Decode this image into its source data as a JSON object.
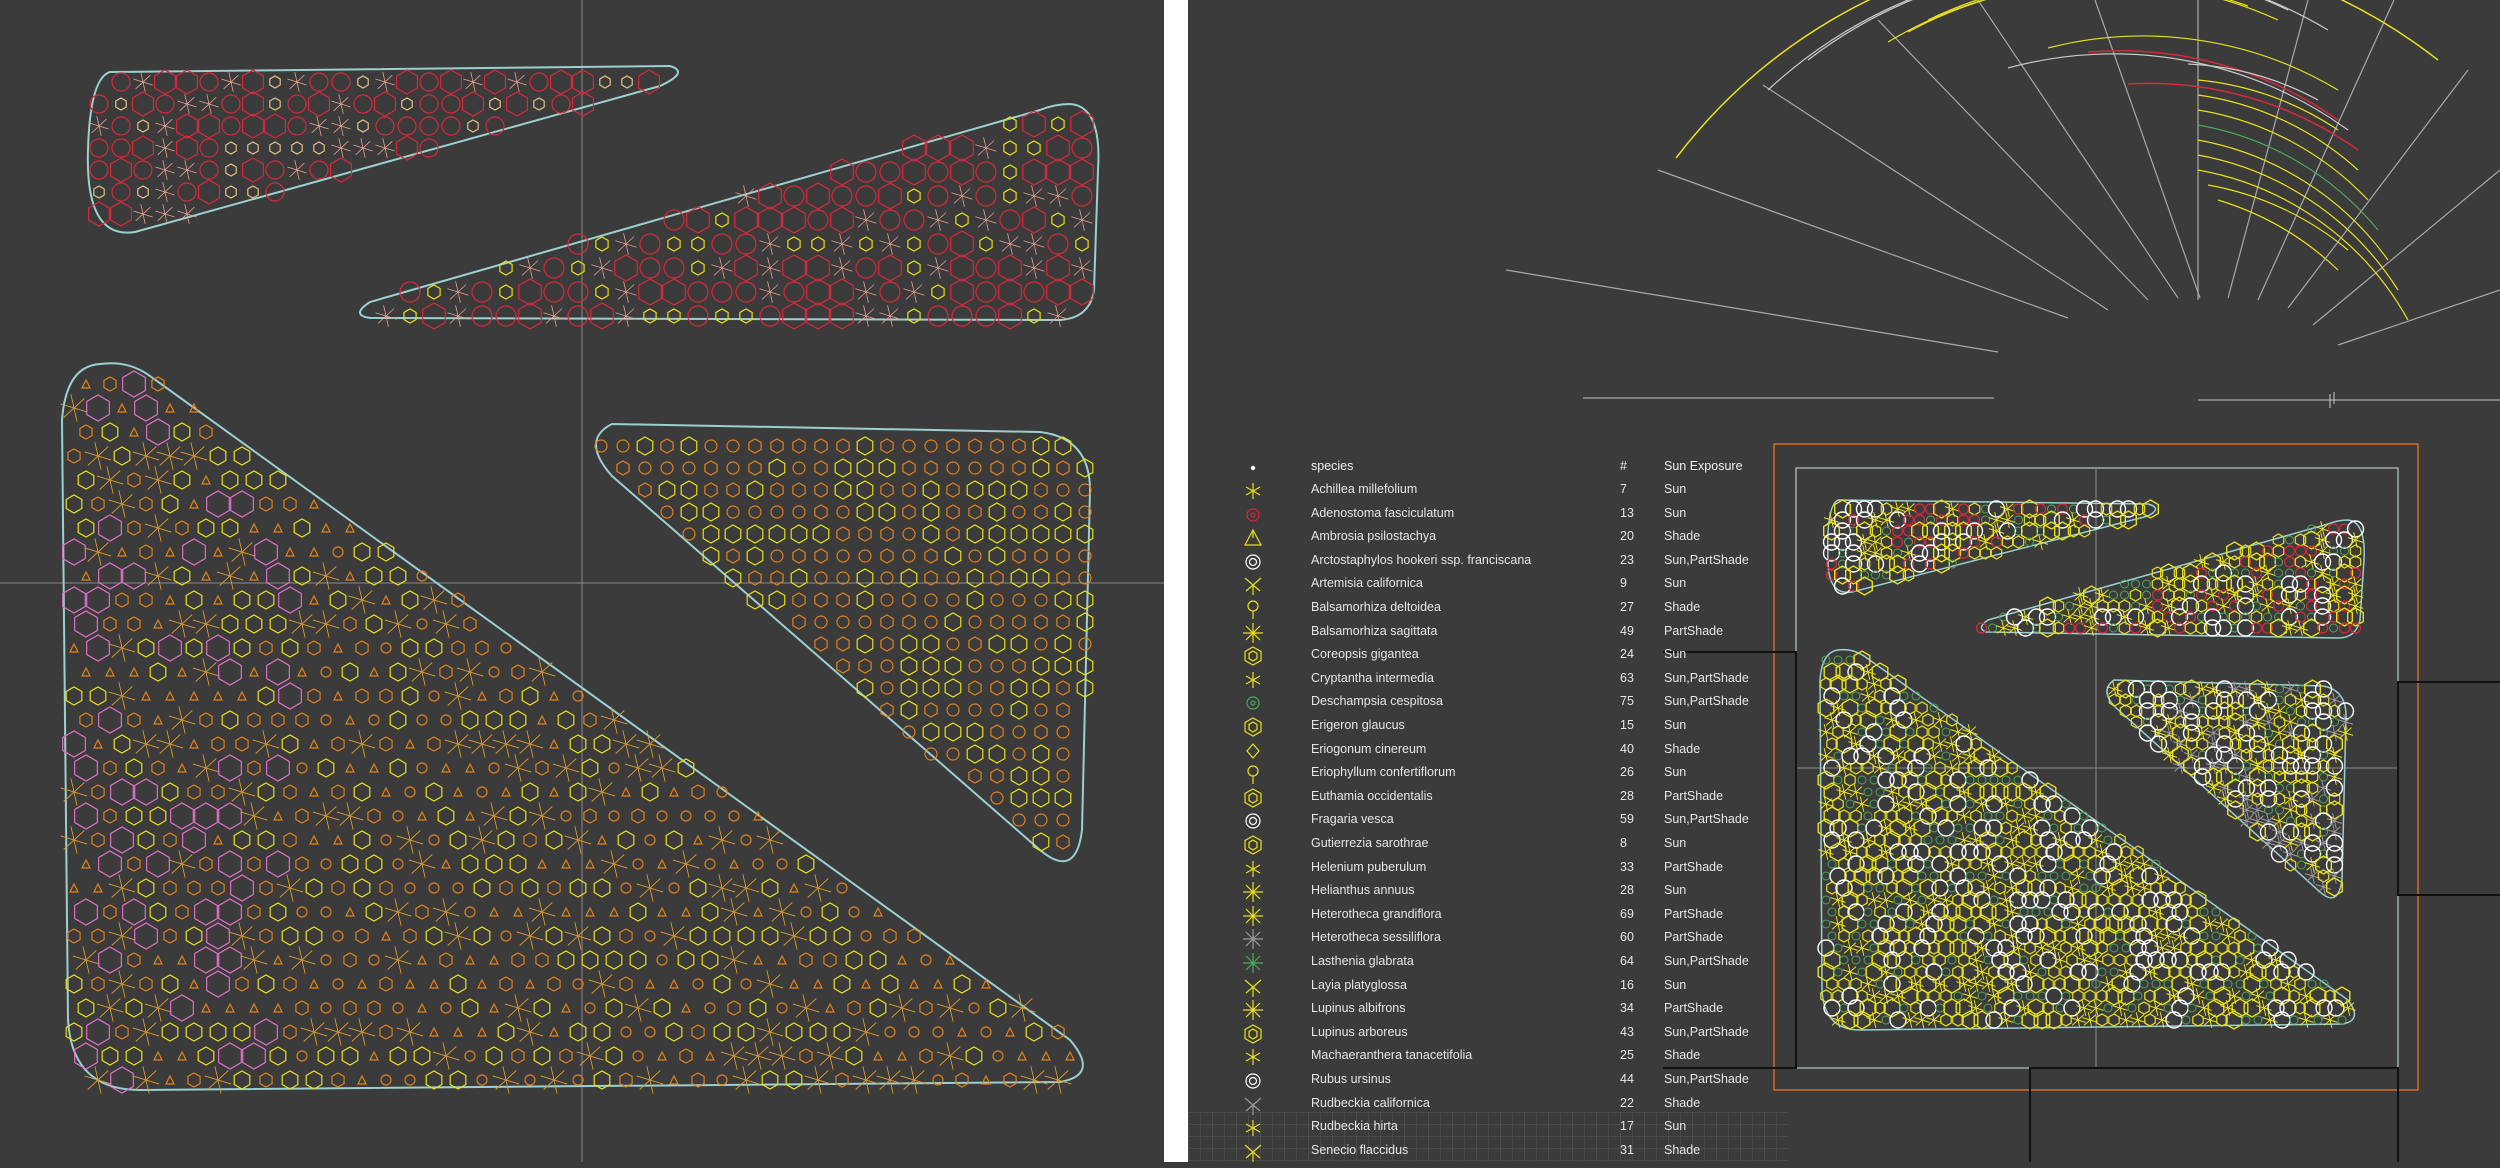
{
  "colors": {
    "background": "#3b3b3b",
    "boundary": "#9ccfcf",
    "red": "#d8283c",
    "orange": "#e0801e",
    "yellow": "#e8e01a",
    "pink": "#e070c8",
    "white": "#ffffff",
    "green": "#4ca85a",
    "frame": "#d86a20"
  },
  "legend": {
    "header": {
      "name": "species",
      "count": "#",
      "sun": "Sun Exposure"
    },
    "rows": [
      {
        "name": "Achillea millefolium",
        "count": "7",
        "sun": "Sun",
        "icon": "asterisk-icon",
        "color": "#e8e01a"
      },
      {
        "name": "Adenostoma fasciculatum",
        "count": "13",
        "sun": "Sun",
        "icon": "circle-icon",
        "color": "#d8283c"
      },
      {
        "name": "Ambrosia psilostachya",
        "count": "20",
        "sun": "Shade",
        "icon": "triangle-icon",
        "color": "#e8e01a"
      },
      {
        "name": "Arctostaphylos hookeri ssp. franciscana",
        "count": "23",
        "sun": "Sun,PartShade",
        "icon": "ring-icon",
        "color": "#ffffff"
      },
      {
        "name": "Artemisia californica",
        "count": "9",
        "sun": "Sun",
        "icon": "fork-icon",
        "color": "#e8e01a"
      },
      {
        "name": "Balsamorhiza deltoidea",
        "count": "27",
        "sun": "Shade",
        "icon": "flower-icon",
        "color": "#e8e01a"
      },
      {
        "name": "Balsamorhiza sagittata",
        "count": "49",
        "sun": "PartShade",
        "icon": "star-icon",
        "color": "#e8e01a"
      },
      {
        "name": "Coreopsis gigantea",
        "count": "24",
        "sun": "Sun",
        "icon": "hexagon-icon",
        "color": "#e8e01a"
      },
      {
        "name": "Cryptantha intermedia",
        "count": "63",
        "sun": "Sun,PartShade",
        "icon": "asterisk-icon",
        "color": "#e8e01a"
      },
      {
        "name": "Deschampsia cespitosa",
        "count": "75",
        "sun": "Sun,PartShade",
        "icon": "circle-icon",
        "color": "#4ca85a"
      },
      {
        "name": "Erigeron glaucus",
        "count": "15",
        "sun": "Sun",
        "icon": "hexagon-icon",
        "color": "#e8e01a"
      },
      {
        "name": "Eriogonum cinereum",
        "count": "40",
        "sun": "Shade",
        "icon": "diamond-icon",
        "color": "#e8e01a"
      },
      {
        "name": "Eriophyllum confertiflorum",
        "count": "26",
        "sun": "Sun",
        "icon": "flower-icon",
        "color": "#e8e01a"
      },
      {
        "name": "Euthamia occidentalis",
        "count": "28",
        "sun": "PartShade",
        "icon": "hexagon-icon",
        "color": "#e8e01a"
      },
      {
        "name": "Fragaria vesca",
        "count": "59",
        "sun": "Sun,PartShade",
        "icon": "ring-icon",
        "color": "#ffffff"
      },
      {
        "name": "Gutierrezia sarothrae",
        "count": "8",
        "sun": "Sun",
        "icon": "hexagon-icon",
        "color": "#e8e01a"
      },
      {
        "name": "Helenium puberulum",
        "count": "33",
        "sun": "PartShade",
        "icon": "asterisk-icon",
        "color": "#e8e01a"
      },
      {
        "name": "Helianthus annuus",
        "count": "28",
        "sun": "Sun",
        "icon": "star-icon",
        "color": "#e8e01a"
      },
      {
        "name": "Heterotheca grandiflora",
        "count": "69",
        "sun": "PartShade",
        "icon": "star-icon",
        "color": "#e8e01a"
      },
      {
        "name": "Heterotheca sessiliflora",
        "count": "60",
        "sun": "PartShade",
        "icon": "star-icon",
        "color": "#9a9a9a"
      },
      {
        "name": "Lasthenia glabrata",
        "count": "64",
        "sun": "Sun,PartShade",
        "icon": "star-icon",
        "color": "#4ca85a"
      },
      {
        "name": "Layia platyglossa",
        "count": "16",
        "sun": "Sun",
        "icon": "fork-icon",
        "color": "#e8e01a"
      },
      {
        "name": "Lupinus albifrons",
        "count": "34",
        "sun": "PartShade",
        "icon": "star-icon",
        "color": "#e8e01a"
      },
      {
        "name": "Lupinus arboreus",
        "count": "43",
        "sun": "Sun,PartShade",
        "icon": "hexagon-icon",
        "color": "#e8e01a"
      },
      {
        "name": "Machaeranthera tanacetifolia",
        "count": "25",
        "sun": "Shade",
        "icon": "asterisk-icon",
        "color": "#e8e01a"
      },
      {
        "name": "Rubus ursinus",
        "count": "44",
        "sun": "Sun,PartShade",
        "icon": "ring-icon",
        "color": "#ffffff"
      },
      {
        "name": "Rudbeckia californica",
        "count": "22",
        "sun": "Shade",
        "icon": "fork-icon",
        "color": "#9a9a9a"
      },
      {
        "name": "Rudbeckia hirta",
        "count": "17",
        "sun": "Sun",
        "icon": "asterisk-icon",
        "color": "#e8e01a"
      },
      {
        "name": "Senecio flaccidus",
        "count": "31",
        "sun": "Shade",
        "icon": "fork-icon",
        "color": "#e8e01a"
      }
    ]
  }
}
